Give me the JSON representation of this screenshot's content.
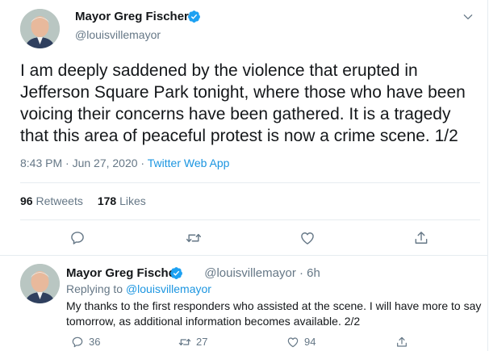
{
  "tweet": {
    "author_name": "Mayor Greg Fischer",
    "author_handle": "@louisvillemayor",
    "text_lines": [
      "I am deeply saddened by the violence that erupted in",
      "Jefferson Square Park tonight, where those who have been",
      "voicing their concerns have been gathered. It is a tragedy",
      "that this area of peaceful protest is now a crime scene. 1/2"
    ],
    "time": "8:43 PM · Jun 27, 2020",
    "separator": " · ",
    "source": "Twitter Web App",
    "retweets_count": "96",
    "retweets_label": "Retweets",
    "likes_count": "178",
    "likes_label": "Likes"
  },
  "reply": {
    "author_name": "Mayor Greg Fischer",
    "author_handle": "@louisvillemayor · 6h",
    "replying_prefix": "Replying to ",
    "replying_to": "@louisvillemayor",
    "text_lines": [
      "My thanks to the first responders who assisted at the scene. I will have more to say",
      "tomorrow, as additional information becomes available. 2/2"
    ],
    "reply_count": "36",
    "retweet_count": "27",
    "like_count": "94"
  },
  "colors": {
    "accent": "#1da1f2",
    "link": "#1b95e0",
    "muted": "#657786",
    "text": "#14171a",
    "divider": "#e6ecf0"
  },
  "icons": {
    "verified": "verified-badge-icon",
    "caret": "chevron-down-icon",
    "reply": "reply-icon",
    "retweet": "retweet-icon",
    "like": "heart-icon",
    "share": "share-icon"
  }
}
